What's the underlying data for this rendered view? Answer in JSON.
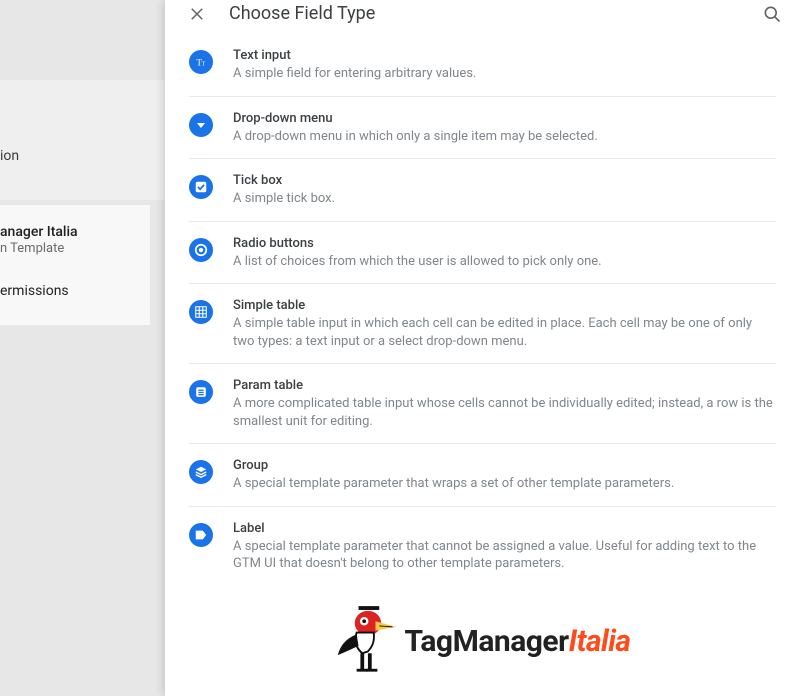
{
  "background": {
    "partial1": "ion",
    "title_fragment": "anager Italia",
    "subtitle_fragment": "n Template",
    "perm_fragment": "ermissions"
  },
  "panel": {
    "title": "Choose Field Type",
    "fields": [
      {
        "title": "Text input",
        "desc": "A simple field for entering arbitrary values."
      },
      {
        "title": "Drop-down menu",
        "desc": "A drop-down menu in which only a single item may be selected."
      },
      {
        "title": "Tick box",
        "desc": "A simple tick box."
      },
      {
        "title": "Radio buttons",
        "desc": "A list of choices from which the user is allowed to pick only one."
      },
      {
        "title": "Simple table",
        "desc": "A simple table input in which each cell can be edited in place. Each cell may be one of only two types: a text input or a select drop-down menu."
      },
      {
        "title": "Param table",
        "desc": "A more complicated table input whose cells cannot be individually edited; instead, a row is the smallest unit for editing."
      },
      {
        "title": "Group",
        "desc": "A special template parameter that wraps a set of other template parameters."
      },
      {
        "title": "Label",
        "desc": "A special template parameter that cannot be assigned a value. Useful for adding text to the GTM UI that doesn't belong to other template parameters."
      }
    ]
  },
  "logo": {
    "text1": "TagManager",
    "text2": "Italia"
  }
}
